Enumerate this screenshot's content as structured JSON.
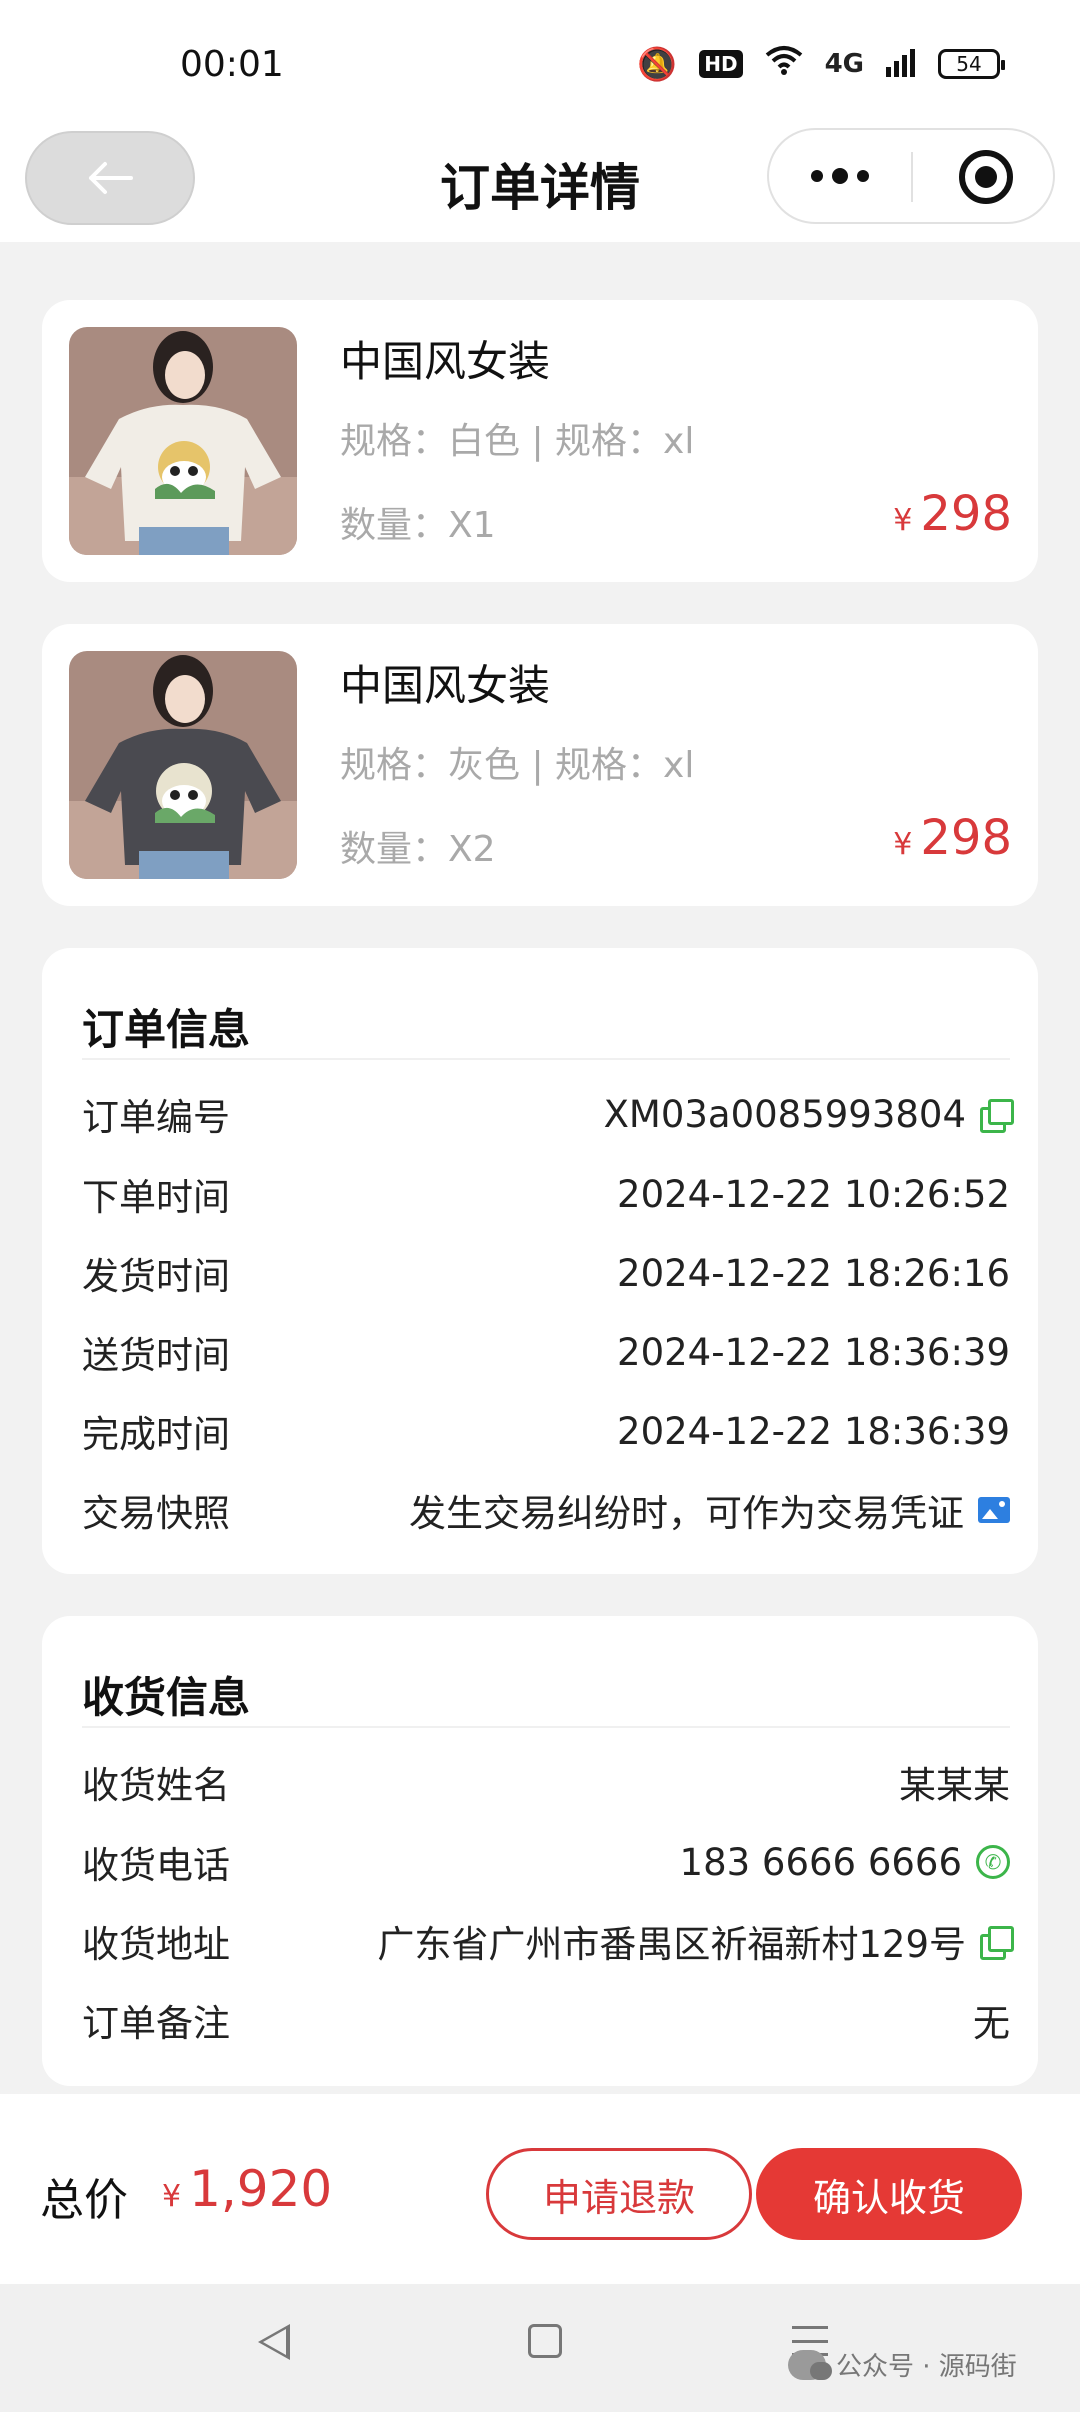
{
  "status_bar": {
    "time": "00:01",
    "hd": "HD",
    "network": "4G",
    "battery": "54"
  },
  "nav": {
    "title": "订单详情"
  },
  "products": [
    {
      "name": "中国风女装",
      "spec": "规格：白色 | 规格：xl",
      "qty": "数量：X1",
      "currency": "¥",
      "price": "298",
      "shirt_color": "#f1ede6"
    },
    {
      "name": "中国风女装",
      "spec": "规格：灰色 | 规格：xl",
      "qty": "数量：X2",
      "currency": "¥",
      "price": "298",
      "shirt_color": "#4a4a50"
    }
  ],
  "order_info": {
    "title": "订单信息",
    "rows": [
      {
        "label": "订单编号",
        "value": "XM03a0085993804"
      },
      {
        "label": "下单时间",
        "value": "2024-12-22 10:26:52"
      },
      {
        "label": "发货时间",
        "value": "2024-12-22 18:26:16"
      },
      {
        "label": "送货时间",
        "value": "2024-12-22 18:36:39"
      },
      {
        "label": "完成时间",
        "value": "2024-12-22 18:36:39"
      },
      {
        "label": "交易快照",
        "value": "发生交易纠纷时，可作为交易凭证"
      }
    ]
  },
  "shipping_info": {
    "title": "收货信息",
    "rows": [
      {
        "label": "收货姓名",
        "value": "某某某"
      },
      {
        "label": "收货电话",
        "value": "183 6666 6666"
      },
      {
        "label": "收货地址",
        "value": "广东省广州市番禺区祈福新村129号"
      },
      {
        "label": "订单备注",
        "value": "无"
      }
    ]
  },
  "footer": {
    "total_label": "总价",
    "currency": "¥",
    "total": "1,920",
    "refund_label": "申请退款",
    "confirm_label": "确认收货"
  },
  "watermark": {
    "text": "公众号 · 源码街"
  },
  "colors": {
    "accent": "#d8393b",
    "confirm_button": "#e53935",
    "copy_icon": "#3cb54a",
    "snapshot_icon": "#2d7fe0",
    "page_background": "#f2f2f2"
  }
}
